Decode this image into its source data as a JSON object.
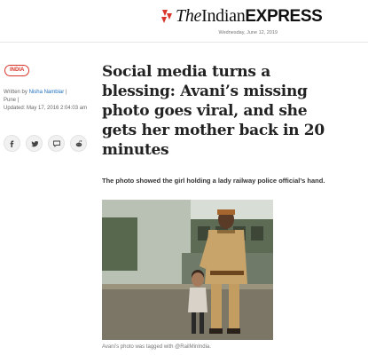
{
  "header": {
    "logo": {
      "the": "The",
      "indian": "Indian",
      "express": "EXPRESS"
    },
    "date": "Wednesday, June 12, 2019"
  },
  "article": {
    "section_badge": "INDIA",
    "byline": {
      "prefix": "Written by",
      "author": "Nisha Nambiar",
      "separator": "|",
      "city": "Pune |",
      "updated": "Updated: May 17, 2016 2:04:03 am"
    },
    "share_icons": [
      "facebook-icon",
      "twitter-icon",
      "comment-icon",
      "reddit-icon"
    ],
    "headline": "Social media turns a blessing: Avani’s missing photo goes viral, and she gets her mother back in 20 minutes",
    "synopsis": "The photo showed the girl holding a lady railway police official’s hand.",
    "image_caption": "Avani’s photo was tagged with @RailMinIndia."
  },
  "colors": {
    "brand_red": "#d9352b",
    "author_link": "#1e6fbf"
  }
}
